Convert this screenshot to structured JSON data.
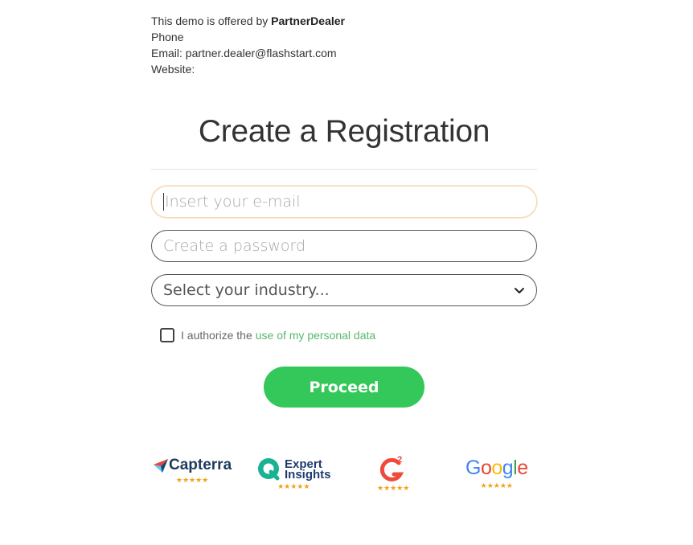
{
  "dealer": {
    "offered_prefix": "This demo is offered by ",
    "dealer_name": "PartnerDealer",
    "phone_label": "Phone",
    "email_line": "Email: partner.dealer@flashstart.com",
    "website_label": "Website:"
  },
  "form": {
    "title": "Create a Registration",
    "email_placeholder": "Insert your e-mail",
    "password_placeholder": "Create a password",
    "industry_selected": "Select your industry...",
    "consent_text": "I authorize the",
    "consent_link": "use of my personal data",
    "proceed_label": "Proceed"
  },
  "badges": {
    "capterra": {
      "label": "Capterra",
      "stars": "★★★★★",
      "icon": "capterra-logo"
    },
    "expert_insights": {
      "line1": "Expert",
      "line2": "Insights",
      "stars": "★★★★★",
      "icon": "expert-insights-logo"
    },
    "g2": {
      "mark": "2",
      "stars": "★★★★★",
      "icon": "g2-logo"
    },
    "google": {
      "letters": [
        "G",
        "o",
        "o",
        "g",
        "l",
        "e"
      ],
      "stars": "★★★★★",
      "icon": "google-logo"
    }
  },
  "colors": {
    "accent_green": "#34c759",
    "link_green": "#57b86b",
    "star_orange": "#f4a11a",
    "google_blue": "#4285f4",
    "google_red": "#ea4335",
    "google_yellow": "#fbbc05",
    "google_green": "#34a853",
    "g2_red": "#ef4a3e"
  }
}
